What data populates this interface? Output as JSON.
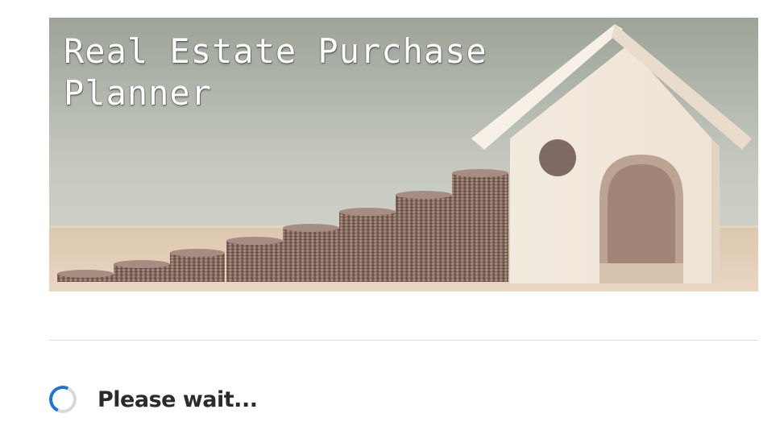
{
  "hero": {
    "title_line1": "Real Estate Purchase",
    "title_line2": "Planner"
  },
  "status": {
    "loading_text": "Please wait..."
  }
}
